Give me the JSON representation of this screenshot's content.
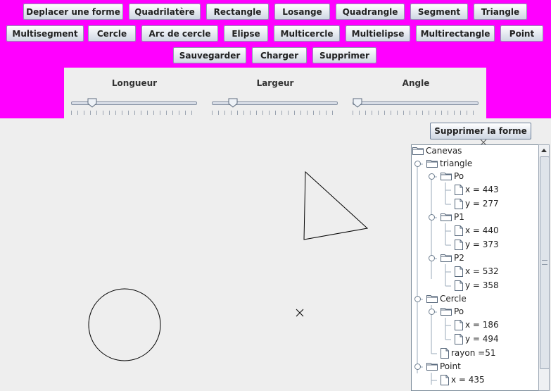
{
  "toolbar": {
    "row1": [
      "Deplacer une forme",
      "Quadrilatère",
      "Rectangle",
      "Losange",
      "Quadrangle",
      "Segment",
      "Triangle"
    ],
    "row2": [
      "Multisegment",
      "Cercle",
      "Arc de cercle",
      "Elipse",
      "Multicercle",
      "Multielipse",
      "Multirectangle",
      "Point"
    ],
    "row3": [
      "Sauvegarder",
      "Charger",
      "Supprimer"
    ]
  },
  "sliders": {
    "longueur": {
      "label": "Longueur",
      "value": 0.14
    },
    "largeur": {
      "label": "Largeur",
      "value": 0.14
    },
    "angle": {
      "label": "Angle",
      "value": 0.0
    }
  },
  "delete_shape_button": "Supprimer la forme",
  "tree": {
    "root": "Canevas",
    "triangle": "triangle",
    "p0": "Po",
    "p0x": "x = 443",
    "p0y": "y = 277",
    "p1": "P1",
    "p1x": "x = 440",
    "p1y": "y = 373",
    "p2": "P2",
    "p2x": "x = 532",
    "p2y": "y = 358",
    "cercle": "Cercle",
    "c0": "Po",
    "c0x": "x = 186",
    "c0y": "y = 494",
    "rayon": "rayon =51",
    "point": "Point",
    "ptx": "x = 435"
  },
  "colors": {
    "toolbar_bg": "#ff00ff",
    "canvas_bg": "#eeeeee"
  }
}
